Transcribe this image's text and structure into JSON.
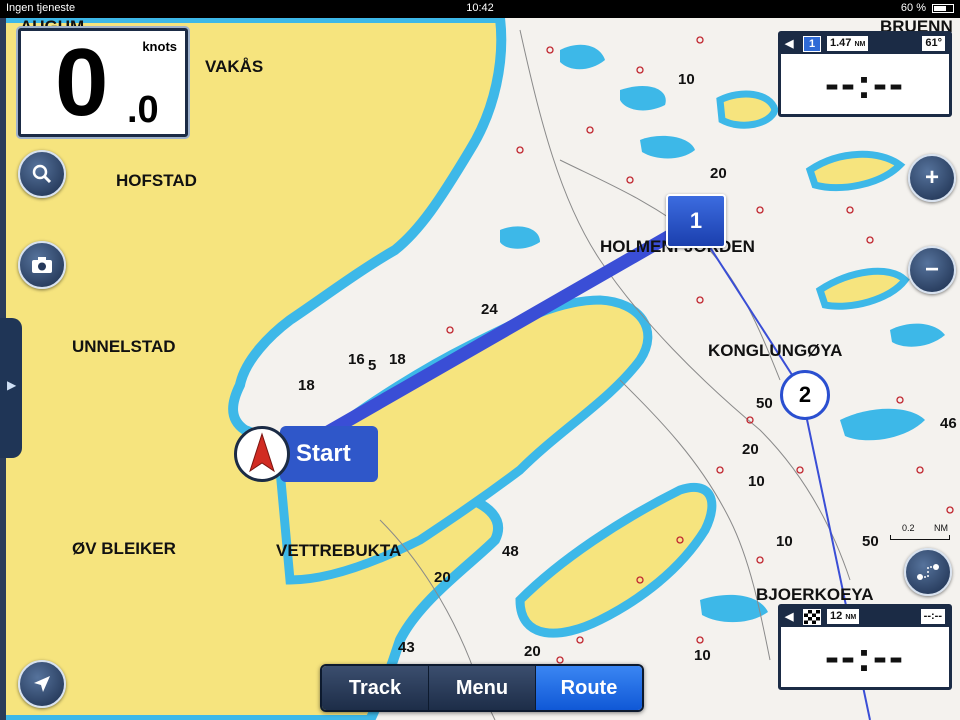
{
  "status_bar": {
    "carrier": "Ingen tjeneste",
    "time": "10:42",
    "battery": "60 %"
  },
  "speed": {
    "value": "0",
    "decimal": ".0",
    "unit": "knots"
  },
  "waypoint_top": {
    "number": "1",
    "distance": "1.47",
    "distance_unit": "NM",
    "bearing": "61°",
    "eta": "--:--"
  },
  "waypoint_bottom": {
    "distance": "12",
    "distance_unit": "NM",
    "eta_small": "--:--",
    "eta": "--:--"
  },
  "map": {
    "places": [
      "AUGUM",
      "VAKÅS",
      "HOFSTAD",
      "UNNELSTAD",
      "ØV BLEIKER",
      "VETTREBUKTA",
      "HOLMENFJORDEN",
      "KONGLUNGØYA",
      "BJOERKOEYA",
      "BRUENN"
    ],
    "depths": [
      "10",
      "20",
      "24",
      "16",
      "5",
      "18",
      "18",
      "50",
      "20",
      "10",
      "10",
      "50",
      "48",
      "20",
      "43",
      "20",
      "10",
      "46"
    ],
    "scale": {
      "value": "0.2",
      "unit": "NM"
    }
  },
  "route": {
    "start_label": "Start",
    "waypoints": [
      "1",
      "2"
    ]
  },
  "toolbar": {
    "items": [
      "Track",
      "Menu",
      "Route"
    ],
    "active": "Route"
  },
  "colors": {
    "land": "#f6e47e",
    "shallow": "#3db8e8",
    "water": "#f4f2ee",
    "route": "#3a4ed6",
    "panel": "#1b2b45"
  },
  "icons": [
    "search-icon",
    "camera-icon",
    "zoom-in-icon",
    "zoom-out-icon",
    "locate-icon",
    "route-tool-icon",
    "boat-icon"
  ]
}
